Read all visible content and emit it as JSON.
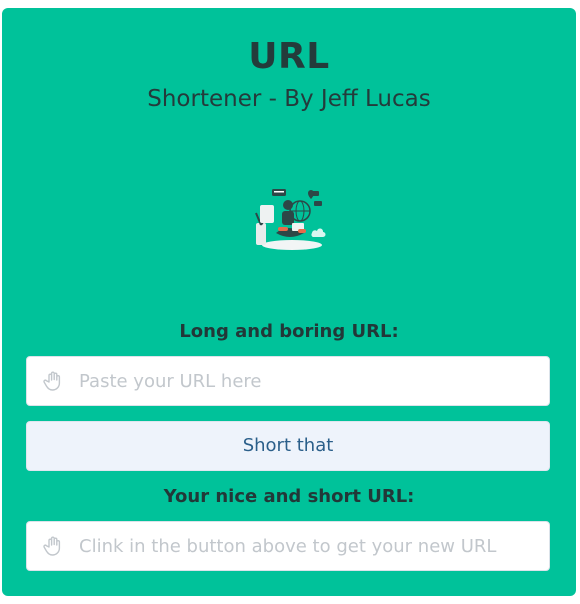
{
  "app": {
    "title": "URL",
    "subtitle": "Shortener - By Jeff Lucas"
  },
  "form": {
    "long_url_label": "Long and boring URL:",
    "long_url_placeholder": "Paste your URL here",
    "long_url_value": "",
    "submit_label": "Short that",
    "short_url_label": "Your nice and short URL:",
    "short_url_placeholder": "Clink in the button above to get your new URL",
    "short_url_value": ""
  },
  "icons": {
    "input_icon": "hand-icon",
    "illustration": "person-with-laptop-illustration"
  },
  "colors": {
    "card_background": "#00c29a",
    "button_background": "#eef3fb",
    "button_text": "#2b5f8a",
    "heading_text": "#243b3b"
  }
}
